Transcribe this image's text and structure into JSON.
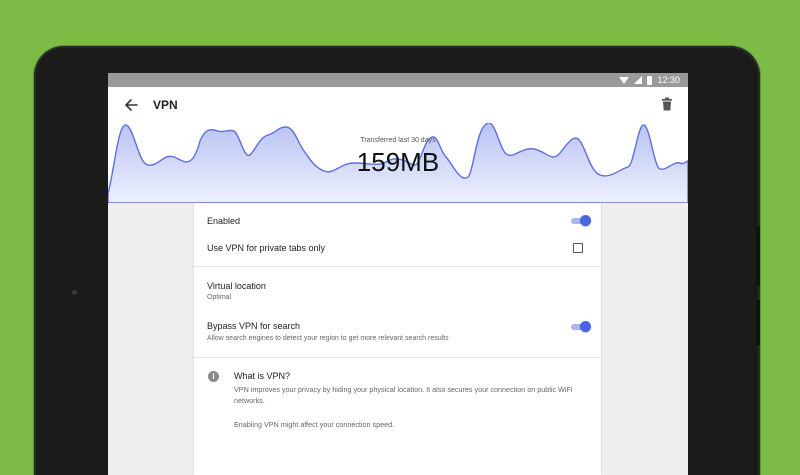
{
  "status_bar": {
    "time": "12:30",
    "icons": [
      "wifi-icon",
      "signal-icon",
      "battery-icon"
    ]
  },
  "app_bar": {
    "title": "VPN",
    "back_icon": "arrow-back-icon",
    "delete_icon": "trash-icon"
  },
  "usage": {
    "label": "Transferred last 30 days",
    "value": "159MB"
  },
  "settings": {
    "enabled": {
      "label": "Enabled",
      "on": true
    },
    "private_tabs": {
      "label": "Use VPN for private tabs only",
      "checked": false
    },
    "virtual_location": {
      "label": "Virtual location",
      "value": "Optimal"
    },
    "bypass_search": {
      "label": "Bypass VPN for search",
      "description": "Allow search engines to detect your region to get more relevant search results",
      "on": true
    }
  },
  "info": {
    "icon": "info-icon",
    "title": "What is VPN?",
    "text": "VPN improves your privacy by hiding your physical location. It also secures your connection on public WiFi networks.",
    "note": "Enabling VPN might affect your connection speed."
  },
  "colors": {
    "background": "#7cbc46",
    "accent": "#4a64e6",
    "chart_line": "#5b6fe0",
    "chart_fill": "#c5cdf6"
  }
}
